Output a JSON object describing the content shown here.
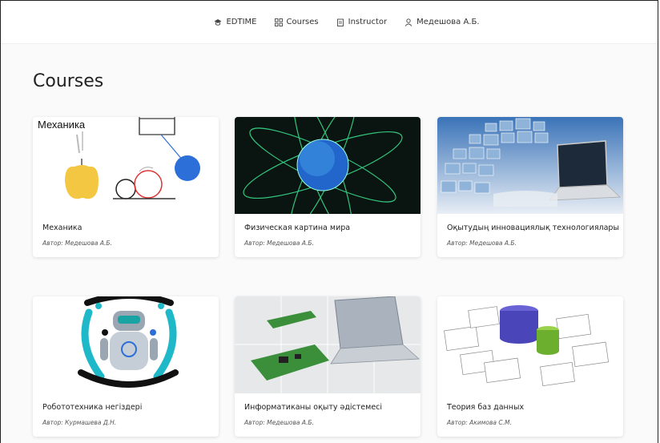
{
  "nav": {
    "brand": "EDTIME",
    "courses": "Courses",
    "instructor": "Instructor",
    "user": "Медешова А.Б."
  },
  "page": {
    "title": "Courses"
  },
  "courses": [
    {
      "title": "Механика",
      "author": "Автор: Медешова А.Б.",
      "thumb_label": "Механика",
      "thumb_icon": "mechanics-illustration"
    },
    {
      "title": "Физическая картина мира",
      "author": "Автор: Медешова А.Б.",
      "thumb_icon": "glowing-globe-image"
    },
    {
      "title": "Оқытудың инновациялық технологиялары",
      "author": "Автор: Медешова А.Б.",
      "thumb_icon": "laptop-media-image"
    },
    {
      "title": "Робототехника негіздері",
      "author": "Автор: Курмашева Д.Н.",
      "thumb_icon": "robot-illustration"
    },
    {
      "title": "Информатиканы оқыту әдістемесі",
      "author": "Автор: Медешова А.Б.",
      "thumb_icon": "laptop-circuit-image"
    },
    {
      "title": "Теория баз данных",
      "author": "Автор: Акимова С.М.",
      "thumb_icon": "database-illustration"
    }
  ]
}
